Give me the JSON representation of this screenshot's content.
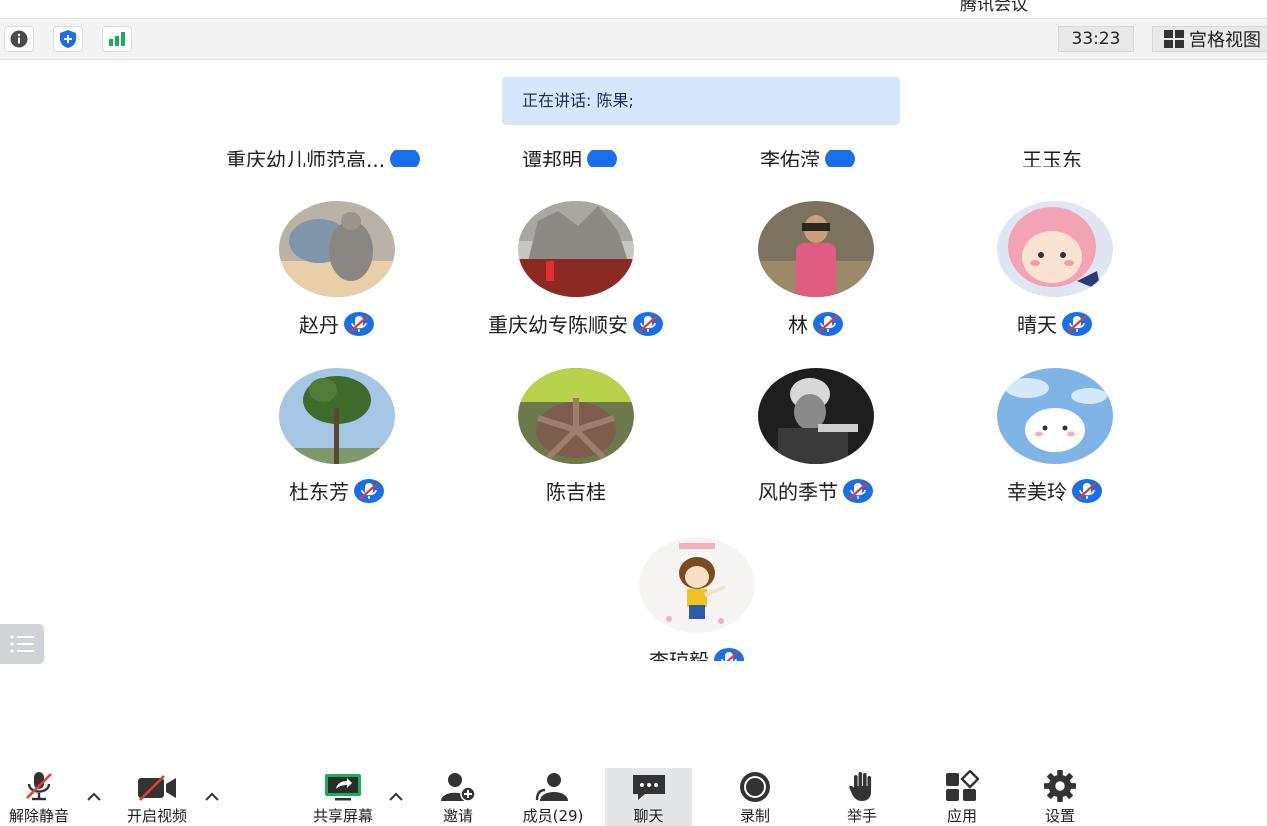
{
  "app": {
    "title": "腾讯会议"
  },
  "topbar": {
    "info_icon": "info-icon",
    "security_icon": "shield-plus-icon",
    "signal_icon": "signal-bars-icon",
    "timer": "33:23",
    "view_label": "宫格视图",
    "view_icon": "grid-view-icon"
  },
  "speaking": {
    "label": "正在讲话: ",
    "name": "陈果;"
  },
  "participants_cut_row": [
    "重庆幼儿师范高...",
    "谭邦明",
    "李佑滢",
    "王玉东"
  ],
  "participants": [
    {
      "name": "赵丹",
      "muted": true
    },
    {
      "name": "重庆幼专陈顺安",
      "muted": true
    },
    {
      "name": "林",
      "muted": true
    },
    {
      "name": "晴天",
      "muted": true
    },
    {
      "name": "杜东芳",
      "muted": true
    },
    {
      "name": "陈吉桂",
      "muted": false
    },
    {
      "name": "风的季节",
      "muted": true
    },
    {
      "name": "幸美玲",
      "muted": true
    },
    {
      "name": "李琼毅",
      "muted": true
    }
  ],
  "bottombar": {
    "unmute": "解除静音",
    "start_video": "开启视频",
    "share_screen": "共享屏幕",
    "invite": "邀请",
    "members": "成员(29)",
    "chat": "聊天",
    "record": "录制",
    "raise_hand": "举手",
    "apps": "应用",
    "settings": "设置"
  },
  "colors": {
    "accent": "#1a6ee8",
    "speaking_bg": "#d6e6fb",
    "share_green": "#1aad5b",
    "signal_green": "#1aad5b"
  }
}
